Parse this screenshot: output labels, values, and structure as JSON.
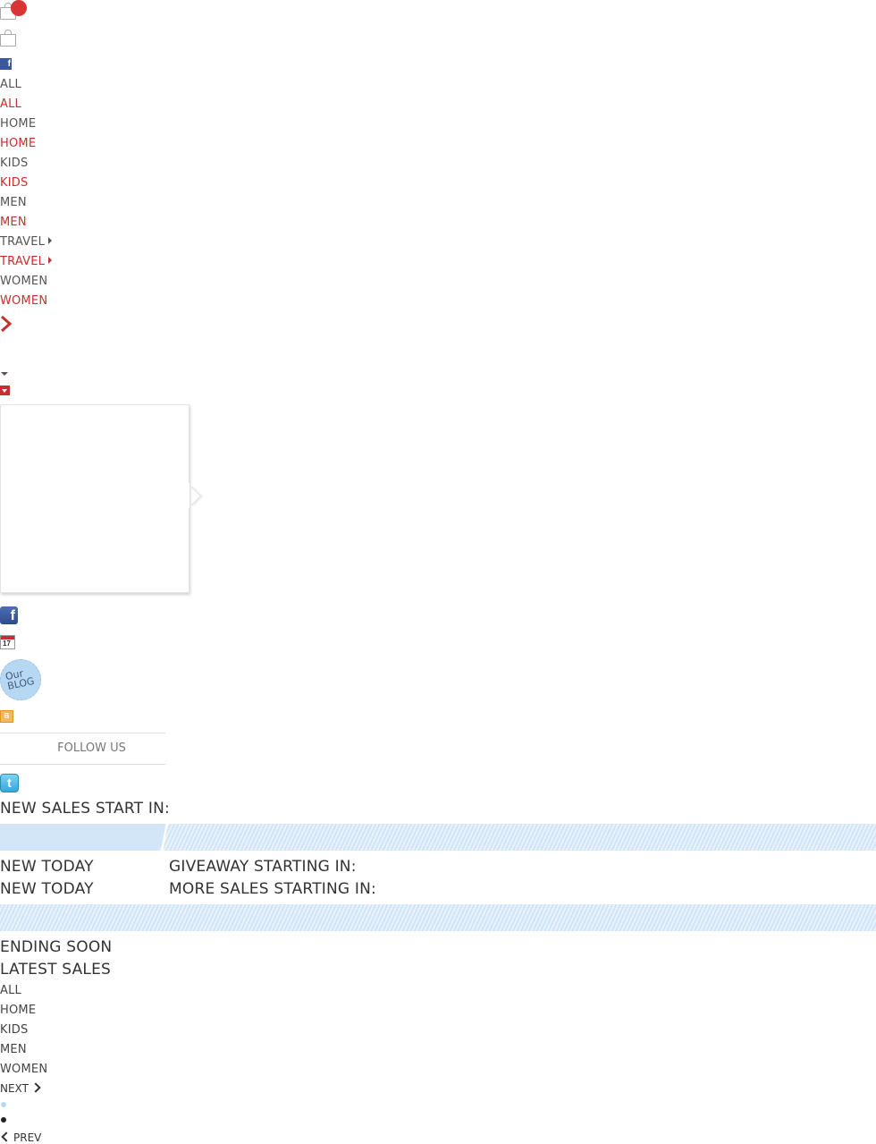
{
  "header": {
    "cart_icon": "shopping-bag-icon",
    "cart_badge_color": "#d93535",
    "bag_icon": "shopping-bag-icon",
    "facebook_icon": "facebook-icon"
  },
  "nav": {
    "items": [
      {
        "label": "ALL",
        "state": "normal"
      },
      {
        "label": "ALL",
        "state": "active"
      },
      {
        "label": "HOME",
        "state": "normal"
      },
      {
        "label": "HOME",
        "state": "active"
      },
      {
        "label": "KIDS",
        "state": "normal"
      },
      {
        "label": "KIDS",
        "state": "active"
      },
      {
        "label": "MEN",
        "state": "normal"
      },
      {
        "label": "MEN",
        "state": "active"
      },
      {
        "label": "TRAVEL",
        "state": "normal",
        "has_submenu": true
      },
      {
        "label": "TRAVEL",
        "state": "active",
        "has_submenu": true
      },
      {
        "label": "WOMEN",
        "state": "normal"
      },
      {
        "label": "WOMEN",
        "state": "active"
      }
    ],
    "accent_color": "#c62f2f",
    "text_color": "#555555"
  },
  "social": {
    "facebook_icon": "facebook-icon",
    "calendar_icon": "calendar-icon",
    "calendar_day": "17",
    "blog_badge_line1": "Our",
    "blog_badge_line2": "BLOG",
    "blogger_icon": "blogger-icon",
    "follow_label": "FOLLOW US",
    "twitter_icon": "twitter-icon"
  },
  "sections": {
    "new_sales_start": "NEW SALES START IN:",
    "new_today_1": "NEW TODAY",
    "giveaway_starting": "GIVEAWAY STARTING IN:",
    "new_today_2": "NEW TODAY",
    "more_sales_starting": "MORE SALES STARTING IN:",
    "ending_soon": "ENDING SOON",
    "latest_sales": "LATEST SALES"
  },
  "filters": [
    "ALL",
    "HOME",
    "KIDS",
    "MEN",
    "WOMEN"
  ],
  "pager": {
    "next_label": "NEXT",
    "prev_label": "PREV"
  }
}
